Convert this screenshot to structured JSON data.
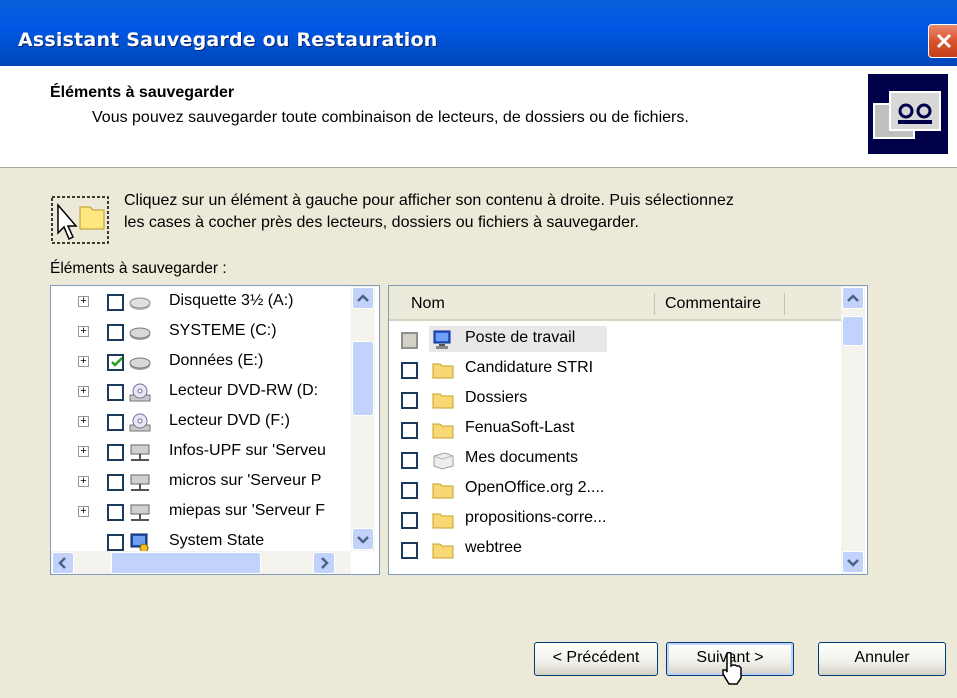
{
  "window": {
    "title": "Assistant Sauvegarde ou Restauration"
  },
  "header": {
    "title": "Éléments à sauvegarder",
    "subtitle": "Vous pouvez sauvegarder toute combinaison de lecteurs, de dossiers ou de fichiers."
  },
  "instructions": {
    "line1": "Cliquez sur un élément à gauche pour afficher son contenu à droite. Puis sélectionnez",
    "line2": "les cases à cocher près des lecteurs, dossiers ou fichiers à sauvegarder."
  },
  "tree": {
    "label": "Éléments à sauvegarder :",
    "items": [
      {
        "label": "Disquette 3½ (A:)",
        "icon": "floppy-drive-icon",
        "checked": false,
        "expandable": true
      },
      {
        "label": "SYSTEME (C:)",
        "icon": "hard-drive-icon",
        "checked": false,
        "expandable": true
      },
      {
        "label": "Données (E:)",
        "icon": "hard-drive-icon",
        "checked": true,
        "expandable": true
      },
      {
        "label": "Lecteur DVD-RW (D:",
        "icon": "dvd-drive-icon",
        "checked": false,
        "expandable": true
      },
      {
        "label": "Lecteur DVD (F:)",
        "icon": "dvd-drive-icon",
        "checked": false,
        "expandable": true
      },
      {
        "label": "Infos-UPF sur 'Serveu",
        "icon": "network-drive-icon",
        "checked": false,
        "expandable": true
      },
      {
        "label": "micros sur 'Serveur P",
        "icon": "network-drive-icon",
        "checked": false,
        "expandable": true
      },
      {
        "label": "miepas sur 'Serveur F",
        "icon": "network-drive-icon",
        "checked": false,
        "expandable": true
      },
      {
        "label": "System State",
        "icon": "system-state-icon",
        "checked": false,
        "expandable": false
      }
    ]
  },
  "content": {
    "columns": {
      "name": "Nom",
      "comment": "Commentaire"
    },
    "items": [
      {
        "label": "Poste de travail",
        "icon": "my-computer-icon",
        "state": "partial"
      },
      {
        "label": "Candidature STRI",
        "icon": "folder-icon",
        "state": "unchecked"
      },
      {
        "label": "Dossiers",
        "icon": "folder-icon",
        "state": "unchecked"
      },
      {
        "label": "FenuaSoft-Last",
        "icon": "folder-icon",
        "state": "unchecked"
      },
      {
        "label": "Mes documents",
        "icon": "my-documents-icon",
        "state": "unchecked"
      },
      {
        "label": "OpenOffice.org 2....",
        "icon": "folder-icon",
        "state": "unchecked"
      },
      {
        "label": "propositions-corre...",
        "icon": "folder-icon",
        "state": "unchecked"
      },
      {
        "label": "webtree",
        "icon": "folder-icon",
        "state": "unchecked"
      }
    ]
  },
  "buttons": {
    "back": "< Précédent",
    "next": "Suivant >",
    "cancel": "Annuler"
  },
  "colors": {
    "titlebar": "#0058E6",
    "face": "#ECE9D8",
    "border": "#7F9DB9",
    "header_icon_bg": "#00004A"
  }
}
